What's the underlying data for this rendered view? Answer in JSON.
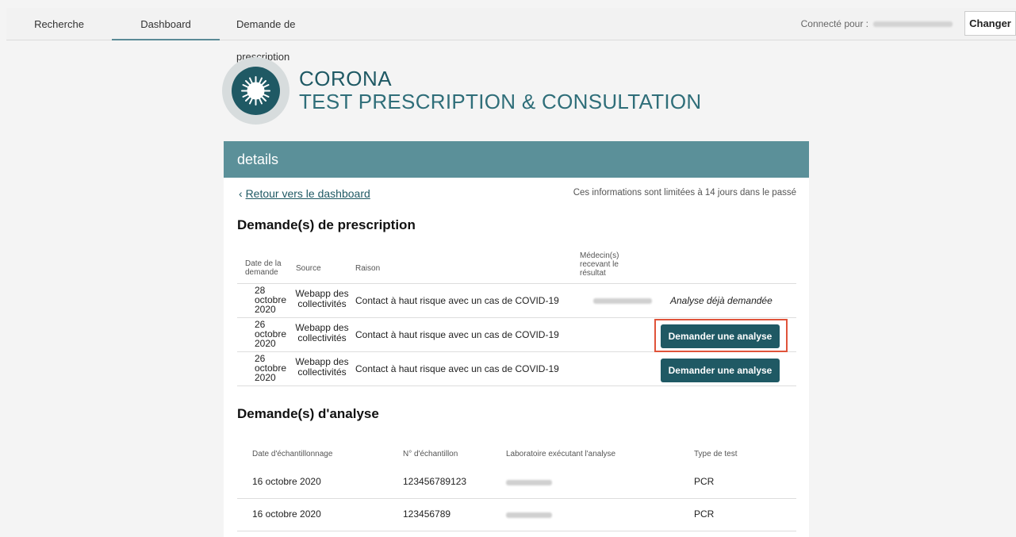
{
  "nav": {
    "tabs": [
      {
        "label": "Recherche"
      },
      {
        "label": "Dashboard"
      },
      {
        "label": "Demande de prescription"
      }
    ],
    "connected_label": "Connecté pour :",
    "change_button": "Changer"
  },
  "header": {
    "title_line1": "CORONA",
    "title_line2": "TEST PRESCRIPTION & CONSULTATION",
    "logo_icon": "virus-icon"
  },
  "card": {
    "header_title": "details",
    "back_arrow": "‹",
    "back_link": "Retour vers le dashboard",
    "info_note": "Ces informations sont limitées à 14 jours dans le passé"
  },
  "prescriptions": {
    "title": "Demande(s) de prescription",
    "columns": {
      "date_l1": "Date de la",
      "date_l2": "demande",
      "source": "Source",
      "raison": "Raison",
      "medecin_l1": "Médecin(s)",
      "medecin_l2": "recevant le",
      "medecin_l3": "résultat"
    },
    "rows": [
      {
        "day": "28",
        "month": "octobre",
        "year": "2020",
        "source_l1": "Webapp des",
        "source_l2": "collectivités",
        "raison": "Contact à haut risque avec un cas de COVID-19",
        "status": "Analyse déjà demandée"
      },
      {
        "day": "26",
        "month": "octobre",
        "year": "2020",
        "source_l1": "Webapp des",
        "source_l2": "collectivités",
        "raison": "Contact à haut risque avec un cas de COVID-19",
        "action": "Demander une analyse"
      },
      {
        "day": "26",
        "month": "octobre",
        "year": "2020",
        "source_l1": "Webapp des",
        "source_l2": "collectivités",
        "raison": "Contact à haut risque avec un cas de COVID-19",
        "action": "Demander une analyse"
      }
    ]
  },
  "analyses": {
    "title": "Demande(s) d'analyse",
    "columns": {
      "date": "Date d'échantillonnage",
      "numero": "N° d'échantillon",
      "labo": "Laboratoire exécutant l'analyse",
      "type": "Type de test"
    },
    "rows": [
      {
        "date": "16 octobre 2020",
        "numero": "123456789123",
        "type": "PCR"
      },
      {
        "date": "16 octobre 2020",
        "numero": "123456789",
        "type": "PCR"
      }
    ]
  },
  "colors": {
    "primary": "#1f5964",
    "header_bar": "#5b9099",
    "highlight": "#e0533a"
  }
}
